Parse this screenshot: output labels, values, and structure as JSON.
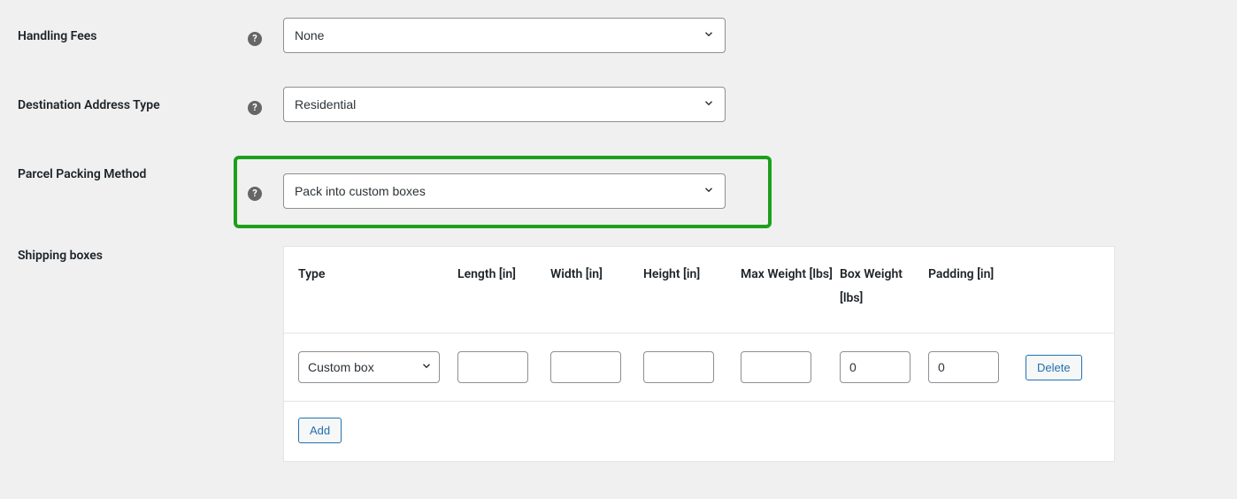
{
  "rows": {
    "handling_fees": {
      "label": "Handling Fees",
      "value": "None"
    },
    "destination_address_type": {
      "label": "Destination Address Type",
      "value": "Residential"
    },
    "parcel_packing_method": {
      "label": "Parcel Packing Method",
      "value": "Pack into custom boxes"
    },
    "shipping_boxes": {
      "label": "Shipping boxes"
    }
  },
  "table": {
    "headers": {
      "type": "Type",
      "length": "Length [in]",
      "width": "Width [in]",
      "height": "Height [in]",
      "max_weight": "Max Weight [lbs]",
      "box_weight": "Box Weight [lbs]",
      "padding": "Padding [in]"
    },
    "row": {
      "type": "Custom box",
      "length": "",
      "width": "",
      "height": "",
      "max_weight": "",
      "box_weight": "0",
      "padding": "0"
    },
    "actions": {
      "delete": "Delete",
      "add": "Add"
    }
  }
}
